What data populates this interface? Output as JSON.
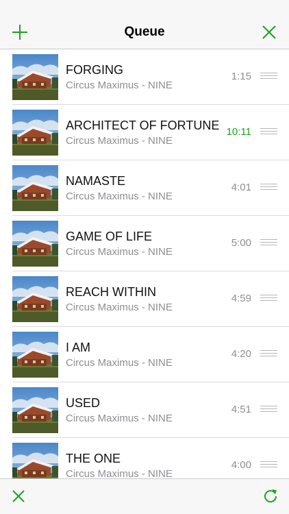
{
  "navbar": {
    "title": "Queue",
    "add_icon": "plus-icon",
    "close_icon": "close-icon"
  },
  "queue": {
    "items": [
      {
        "title": "FORGING",
        "subtitle": "Circus Maximus - NINE",
        "duration": "1:15",
        "playing": false
      },
      {
        "title": "ARCHITECT OF FORTUNE",
        "subtitle": "Circus Maximus - NINE",
        "duration": "10:11",
        "playing": true
      },
      {
        "title": "NAMASTE",
        "subtitle": "Circus Maximus - NINE",
        "duration": "4:01",
        "playing": false
      },
      {
        "title": "GAME OF LIFE",
        "subtitle": "Circus Maximus - NINE",
        "duration": "5:00",
        "playing": false
      },
      {
        "title": "REACH WITHIN",
        "subtitle": "Circus Maximus - NINE",
        "duration": "4:59",
        "playing": false
      },
      {
        "title": "I AM",
        "subtitle": "Circus Maximus - NINE",
        "duration": "4:20",
        "playing": false
      },
      {
        "title": "USED",
        "subtitle": "Circus Maximus - NINE",
        "duration": "4:51",
        "playing": false
      },
      {
        "title": "THE ONE",
        "subtitle": "Circus Maximus - NINE",
        "duration": "4:00",
        "playing": false
      }
    ]
  },
  "toolbar": {
    "clear_icon": "close-icon",
    "repeat_icon": "repeat-icon"
  },
  "colors": {
    "accent": "#1aa31a",
    "secondary_text": "#8e8e93"
  }
}
